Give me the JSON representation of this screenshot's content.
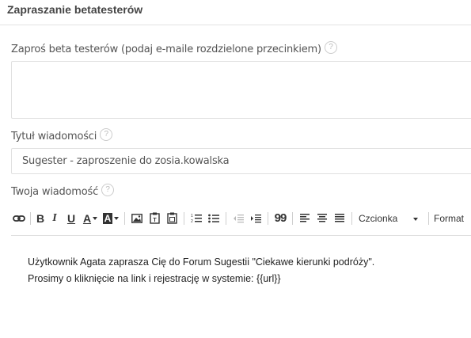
{
  "page": {
    "title": "Zapraszanie betatesterów"
  },
  "emails": {
    "label": "Zaproś beta testerów (podaj e-maile rozdzielone przecinkiem)",
    "value": ""
  },
  "subject": {
    "label": "Tytuł wiadomości",
    "value": "Sugester - zaproszenie do zosia.kowalska"
  },
  "message": {
    "label": "Twoja wiadomość"
  },
  "help": {
    "glyph": "?"
  },
  "toolbar": {
    "bold": "B",
    "italic": "I",
    "underline": "U",
    "text_color": "A",
    "bg_color": "A",
    "quote": "99",
    "font_dropdown": "Czcionka",
    "format_dropdown": "Format",
    "icons": [
      "link-icon",
      "image-icon",
      "paste-text-icon",
      "paste-word-icon",
      "ordered-list-icon",
      "unordered-list-icon",
      "outdent-icon",
      "indent-icon",
      "blockquote-icon",
      "align-left-icon",
      "align-center-icon",
      "align-justify-icon"
    ]
  },
  "editor": {
    "lines": [
      "Użytkownik Agata zaprasza Cię do Forum Sugestii \"Ciekawe kierunki podróży\".",
      "Prosimy o kliknięcie na link i rejestrację w systemie: {{url}}"
    ]
  },
  "colors": {
    "border": "#e0e0e0",
    "label": "#555555",
    "text": "#222222"
  }
}
